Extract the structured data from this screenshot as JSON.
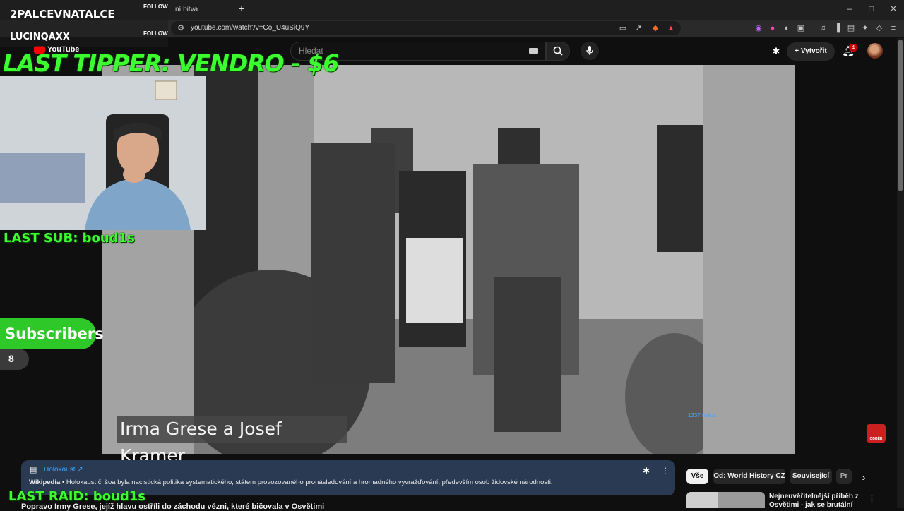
{
  "browser": {
    "tab_title": "ní bitva",
    "new_tab_label": "+",
    "url": "youtube.com/watch?v=Co_U4uSiQ9Y",
    "window_controls": {
      "minimize": "–",
      "maximize": "□",
      "close": "✕"
    }
  },
  "youtube": {
    "logo_text": "YouTube",
    "search_placeholder": "Hledat",
    "create_label": "Vytvořit",
    "notification_count": "4"
  },
  "video": {
    "subtitle": "Irma Grese a Josef Kramer",
    "watermark": "1337maros",
    "subscribe_badge": "ODBĚR"
  },
  "info_panel": {
    "title": "Holokaust ↗",
    "source": "Wikipedia",
    "body": " • Holokaust či šoa byla nacistická politika systematického, státem provozovaného pronásledování a hromadného vyvražďování, především osob židovské národnosti."
  },
  "chips": [
    "Vše",
    "Od: World History CZ",
    "Související",
    "Pr"
  ],
  "recommendation": {
    "title": "Nejneuvěřitelnější příběh z Osvětimi - jak se brutální"
  },
  "bottom_title": "Popravo Irmy Grese, jejíž hlavu ostříli do záchodu vězni, které bičovala v Osvětimi",
  "overlay": {
    "follow_1_name": "2PALCEVNATALCE",
    "follow_1_tag": "FOLLOW",
    "follow_2_name": "LUCINQAXX",
    "follow_2_tag": "FOLLOW",
    "last_tipper": "LAST TIPPER: VENDRO - $6",
    "last_sub": "LAST SUB: boud1s",
    "subscribers_label": "Subscribers",
    "subscribers_count": "8",
    "last_raid": "LAST RAID: boud1s"
  },
  "colors": {
    "neon_green": "#3bff2f",
    "yt_red": "#ff0000",
    "info_link": "#3ea6ff"
  }
}
